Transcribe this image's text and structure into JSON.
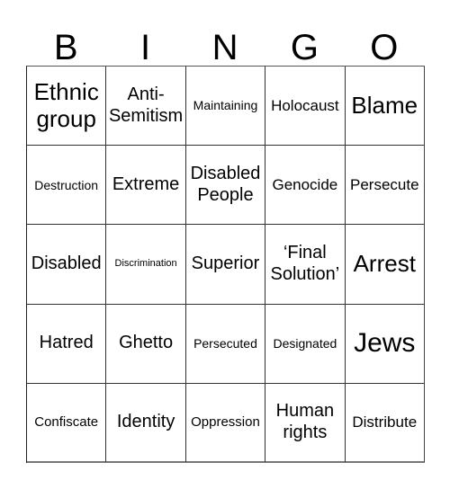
{
  "header": {
    "letters": [
      "B",
      "I",
      "N",
      "G",
      "O"
    ]
  },
  "grid": {
    "rows": [
      [
        "Ethnic group",
        "Anti-Semitism",
        "Maintaining",
        "Holocaust",
        "Blame"
      ],
      [
        "Destruction",
        "Extreme",
        "Disabled People",
        "Genocide",
        "Persecute"
      ],
      [
        "Disabled",
        "Discrimination",
        "Superior",
        "‘Final Solution’",
        "Arrest"
      ],
      [
        "Hatred",
        "Ghetto",
        "Persecuted",
        "Designated",
        "Jews"
      ],
      [
        "Confiscate",
        "Identity",
        "Oppression",
        "Human rights",
        "Distribute"
      ]
    ],
    "display": {
      "r0c0": [
        "Ethnic",
        "group"
      ],
      "r0c1": [
        "Anti-",
        "Semitism"
      ],
      "r1c2": [
        "Disabled",
        "People"
      ],
      "r2c3": [
        "‘Final",
        "Solution’"
      ],
      "r4c3": [
        "Human",
        "rights"
      ]
    }
  }
}
